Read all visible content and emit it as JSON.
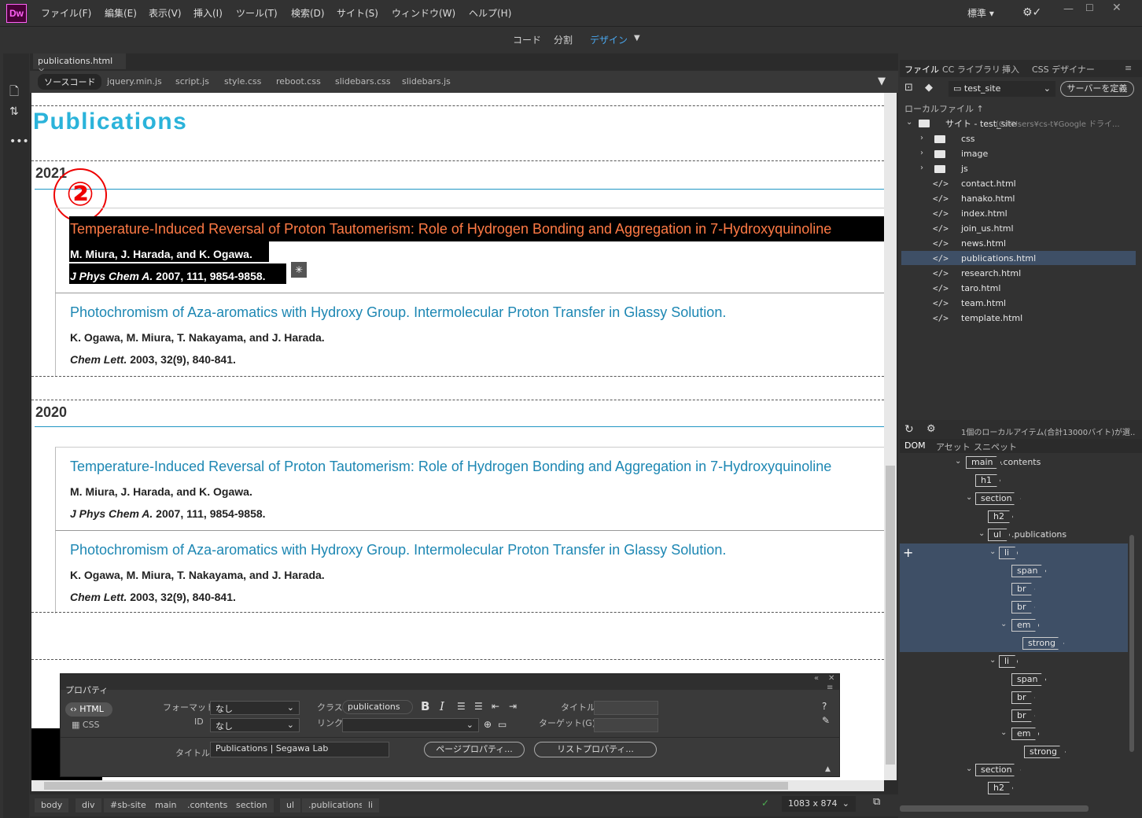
{
  "app": {
    "logo": "Dw"
  },
  "menu": [
    "ファイル(F)",
    "編集(E)",
    "表示(V)",
    "挿入(I)",
    "ツール(T)",
    "検索(D)",
    "サイト(S)",
    "ウィンドウ(W)",
    "ヘルプ(H)"
  ],
  "workspace": "標準",
  "modes": {
    "code": "コード",
    "split": "分割",
    "design": "デザイン"
  },
  "doc_tab": "publications.html",
  "related_files": [
    "ソースコード",
    "jquery.min.js",
    "script.js",
    "style.css",
    "reboot.css",
    "slidebars.css",
    "slidebars.js"
  ],
  "page": {
    "title": "Publications",
    "annotation": "②",
    "years": [
      {
        "year": "2021",
        "items": [
          {
            "title": "Temperature-Induced Reversal of Proton Tautomerism: Role of Hydrogen Bonding and Aggregation in 7-Hydroxyquinoline",
            "authors": "M. Miura, J. Harada, and K. Ogawa.",
            "journal": "J Phys Chem A.",
            "cite": " 2007, 111, 9854-9858."
          },
          {
            "title": "Photochromism of Aza-aromatics with Hydroxy Group. Intermolecular Proton Transfer in Glassy Solution.",
            "authors": "K. Ogawa, M. Miura, T. Nakayama, and J. Harada.",
            "journal": "Chem Lett.",
            "cite": " 2003, 32(9), 840-841."
          }
        ]
      },
      {
        "year": "2020",
        "items": [
          {
            "title": "Temperature-Induced Reversal of Proton Tautomerism: Role of Hydrogen Bonding and Aggregation in 7-Hydroxyquinoline",
            "authors": "M. Miura, J. Harada, and K. Ogawa.",
            "journal": "J Phys Chem A.",
            "cite": " 2007, 111, 9854-9858."
          },
          {
            "title": "Photochromism of Aza-aromatics with Hydroxy Group. Intermolecular Proton Transfer in Glassy Solution.",
            "authors": "K. Ogawa, M. Miura, T. Nakayama, and J. Harada.",
            "journal": "Chem Lett.",
            "cite": " 2003, 32(9), 840-841."
          }
        ]
      }
    ]
  },
  "statusbar": {
    "crumbs": [
      "body",
      "div",
      "#sb-site",
      "main",
      ".contents",
      "section",
      "ul",
      ".publications",
      "li"
    ],
    "size": "1083 x 874"
  },
  "panel": {
    "tabs": [
      "ファイル",
      "CC ライブラリ",
      "挿入",
      "CSS デザイナー"
    ],
    "site": "test_site",
    "server_btn": "サーバーを定義",
    "local_label": "ローカルファイル ↑",
    "root": "サイト - test_site",
    "root_path": "(C:¥Users¥cs-t¥Google ドライ...",
    "folders": [
      "css",
      "image",
      "js"
    ],
    "files": [
      "contact.html",
      "hanako.html",
      "index.html",
      "join_us.html",
      "news.html",
      "publications.html",
      "research.html",
      "taro.html",
      "team.html",
      "template.html"
    ],
    "status": "1個のローカルアイテム(合計13000バイト)が選...",
    "dom_tabs": [
      "DOM",
      "アセット",
      "スニペット"
    ],
    "dom": {
      "main": "main",
      "main_class": ".contents",
      "h1": "h1",
      "section": "section",
      "h2": "h2",
      "ul": "ul",
      "ul_class": ".publications",
      "li": "li",
      "span": "span",
      "br": "br",
      "em": "em",
      "strong": "strong"
    }
  },
  "props": {
    "title": "プロパティ",
    "html": "HTML",
    "css": "CSS",
    "format_label": "フォーマット",
    "format_value": "なし",
    "id_label": "ID",
    "id_value": "なし",
    "class_label": "クラス",
    "class_value": "publications",
    "link_label": "リンク",
    "title_label": "タイトル",
    "target_label": "ターゲット(G)",
    "page_title_label": "タイトル",
    "page_title_value": "Publications | Segawa Lab",
    "page_props": "ページプロパティ...",
    "list_props": "リストプロパティ..."
  },
  "colors": {
    "accent": "#2bb3da",
    "title_link": "#1d87b3",
    "selected_title": "#ff7a45",
    "panel": "#323232"
  }
}
